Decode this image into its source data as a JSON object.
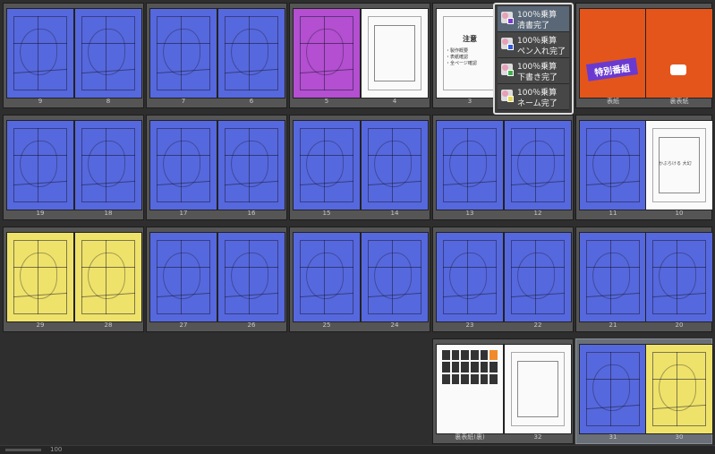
{
  "colors": {
    "background": "#2e2e2e",
    "spread_bg": "#555555",
    "clean_done": "#5668dd",
    "pen_done": "#efe26a",
    "draft_done": "#5668dd",
    "name_done": "#fafafa",
    "popup_border": "#dddddd"
  },
  "spreads": [
    {
      "id": "s1",
      "pages": [
        {
          "label": "9",
          "style": "blue"
        },
        {
          "label": "8",
          "style": "blue"
        }
      ]
    },
    {
      "id": "s2",
      "pages": [
        {
          "label": "7",
          "style": "blue"
        },
        {
          "label": "6",
          "style": "blue"
        }
      ]
    },
    {
      "id": "s3",
      "pages": [
        {
          "label": "5",
          "style": "purple"
        },
        {
          "label": "4",
          "style": "white"
        }
      ]
    },
    {
      "id": "s4",
      "pages": [
        {
          "label": "3",
          "style": "white",
          "note": true
        },
        {
          "label": "",
          "style": "blank"
        }
      ]
    },
    {
      "id": "s5",
      "pages": [
        {
          "label": "表紙",
          "style": "orange",
          "cover": true
        },
        {
          "label": "裏表紙",
          "style": "orange"
        }
      ]
    },
    {
      "id": "s6",
      "pages": [
        {
          "label": "19",
          "style": "blue"
        },
        {
          "label": "18",
          "style": "blue"
        }
      ]
    },
    {
      "id": "s7",
      "pages": [
        {
          "label": "17",
          "style": "blue"
        },
        {
          "label": "16",
          "style": "blue"
        }
      ]
    },
    {
      "id": "s8",
      "pages": [
        {
          "label": "15",
          "style": "blue"
        },
        {
          "label": "14",
          "style": "blue"
        }
      ]
    },
    {
      "id": "s9",
      "pages": [
        {
          "label": "13",
          "style": "blue"
        },
        {
          "label": "12",
          "style": "blue"
        }
      ]
    },
    {
      "id": "s10",
      "pages": [
        {
          "label": "11",
          "style": "blue"
        },
        {
          "label": "10",
          "style": "white",
          "caption": true
        }
      ]
    },
    {
      "id": "s11",
      "pages": [
        {
          "label": "29",
          "style": "yellow"
        },
        {
          "label": "28",
          "style": "yellow"
        }
      ]
    },
    {
      "id": "s12",
      "pages": [
        {
          "label": "27",
          "style": "blue"
        },
        {
          "label": "26",
          "style": "blue"
        }
      ]
    },
    {
      "id": "s13",
      "pages": [
        {
          "label": "25",
          "style": "blue"
        },
        {
          "label": "24",
          "style": "blue"
        }
      ]
    },
    {
      "id": "s14",
      "pages": [
        {
          "label": "23",
          "style": "blue"
        },
        {
          "label": "22",
          "style": "blue"
        }
      ]
    },
    {
      "id": "s15",
      "pages": [
        {
          "label": "21",
          "style": "blue"
        },
        {
          "label": "20",
          "style": "blue"
        }
      ]
    },
    {
      "id": "s16",
      "pages": [
        {
          "label": "裏表紙(裏)",
          "style": "white",
          "grid": true
        },
        {
          "label": "32",
          "style": "white"
        }
      ]
    },
    {
      "id": "s17",
      "selected": true,
      "pages": [
        {
          "label": "31",
          "style": "blue"
        },
        {
          "label": "30",
          "style": "yellow"
        }
      ]
    }
  ],
  "page3_note": {
    "title": "注意",
    "body": [
      "・製作概要",
      "・表紙確認",
      "・全ページ確認"
    ]
  },
  "page10_caption": "かぶらける 大幻",
  "cover_title": "特別番組",
  "status_popup": {
    "rows": [
      {
        "line1": "100％乗算",
        "line2": "清書完了",
        "color": "#7a3ad8",
        "active": true
      },
      {
        "line1": "100％乗算",
        "line2": "ペン入れ完了",
        "color": "#2f5be0",
        "active": false
      },
      {
        "line1": "100％乗算",
        "line2": "下書き完了",
        "color": "#3fb34a",
        "active": false
      },
      {
        "line1": "100％乗算",
        "line2": "ネーム完了",
        "color": "#e8d84a",
        "active": false
      }
    ]
  },
  "statusbar": {
    "zoom": "100"
  }
}
